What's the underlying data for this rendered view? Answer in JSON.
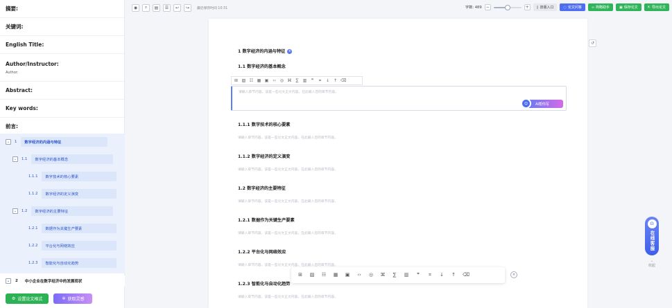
{
  "sidebar": {
    "meta": {
      "abstract_cn": "摘要:",
      "keywords_cn": "关键词:",
      "english_title": "English Title:",
      "author_instructor": "Author/Instructor:",
      "author_sub": "Author:",
      "abstract_en": "Abstract:",
      "keywords_en": "Key words:",
      "preface": "前言:"
    },
    "outline": [
      {
        "num": "1",
        "title": "数字经济的内涵与特征"
      },
      {
        "num": "1.1",
        "title": "数字经济的基本概念"
      },
      {
        "num": "1.1.1",
        "title": "数字技术的核心要素"
      },
      {
        "num": "1.1.2",
        "title": "数字经济的定义演变"
      },
      {
        "num": "1.2",
        "title": "数字经济的主要特征"
      },
      {
        "num": "1.2.1",
        "title": "数据作为关键生产要素"
      },
      {
        "num": "1.2.2",
        "title": "平台化与网络效应"
      },
      {
        "num": "1.2.3",
        "title": "智能化与自动化趋势"
      }
    ],
    "chapter2": {
      "num": "2",
      "title": "中小企业在数字经济中的发展现状"
    },
    "buttons": {
      "format_label": "设置论文格式",
      "inspire_label": "获取灵感"
    }
  },
  "toolbar": {
    "save_time": "最近保存时间 10:31",
    "word_count": "字数: 489",
    "zoom_level": 0.5,
    "old_entry": "旧版入口",
    "qa": "论文问答",
    "outline_helper": "简略助手",
    "save_paper": "保存论文",
    "export_paper": "导出论文"
  },
  "document": {
    "h1": "1 数字经济的内涵与特征",
    "h1_badge": "+",
    "h2_1": "1.1 数字经济的基本概念",
    "editor_placeholder": "请输入章节内容。该是一些论文正文内容。在此输入您的章节内容。",
    "ai_button": "AI帮你写",
    "sections": [
      {
        "heading": "1.1.1 数字技术的核心要素",
        "placeholder": "请输入章节内容。该是一些论文正文内容。在此输入您的章节内容。"
      },
      {
        "heading": "1.1.2 数字经济的定义演变",
        "placeholder": "请输入章节内容。该是一些论文正文内容。在此输入您的章节内容。"
      },
      {
        "heading": "1.2 数字经济的主要特征",
        "placeholder": "请输入章节内容。该是一些论文正文内容。在此输入您的章节内容。"
      },
      {
        "heading": "1.2.1 数据作为关键生产要素",
        "placeholder": "请输入章节内容。该是一些论文正文内容。在此输入您的章节内容。"
      },
      {
        "heading": "1.2.2 平台化与网络效应",
        "placeholder": "请输入章节内容。该是一些论文正文内容。在此输入您的章节内容。"
      },
      {
        "heading": "1.2.3 智能化与自动化趋势",
        "placeholder": "请输入章节内容。该是一些论文正文内容。在此输入您的章节内容。"
      }
    ]
  },
  "support": {
    "label": "在线客服",
    "collapse": "收起"
  },
  "icons": [
    "eye-icon",
    "search-icon",
    "save-icon",
    "outline-icon",
    "undo-icon",
    "redo-icon",
    "history-icon",
    "close-icon",
    "robot-icon",
    "headset-icon"
  ],
  "colors": {
    "accent": "#4e6ef2",
    "green": "#2db155",
    "outline_bg": "#eaf1fd"
  }
}
